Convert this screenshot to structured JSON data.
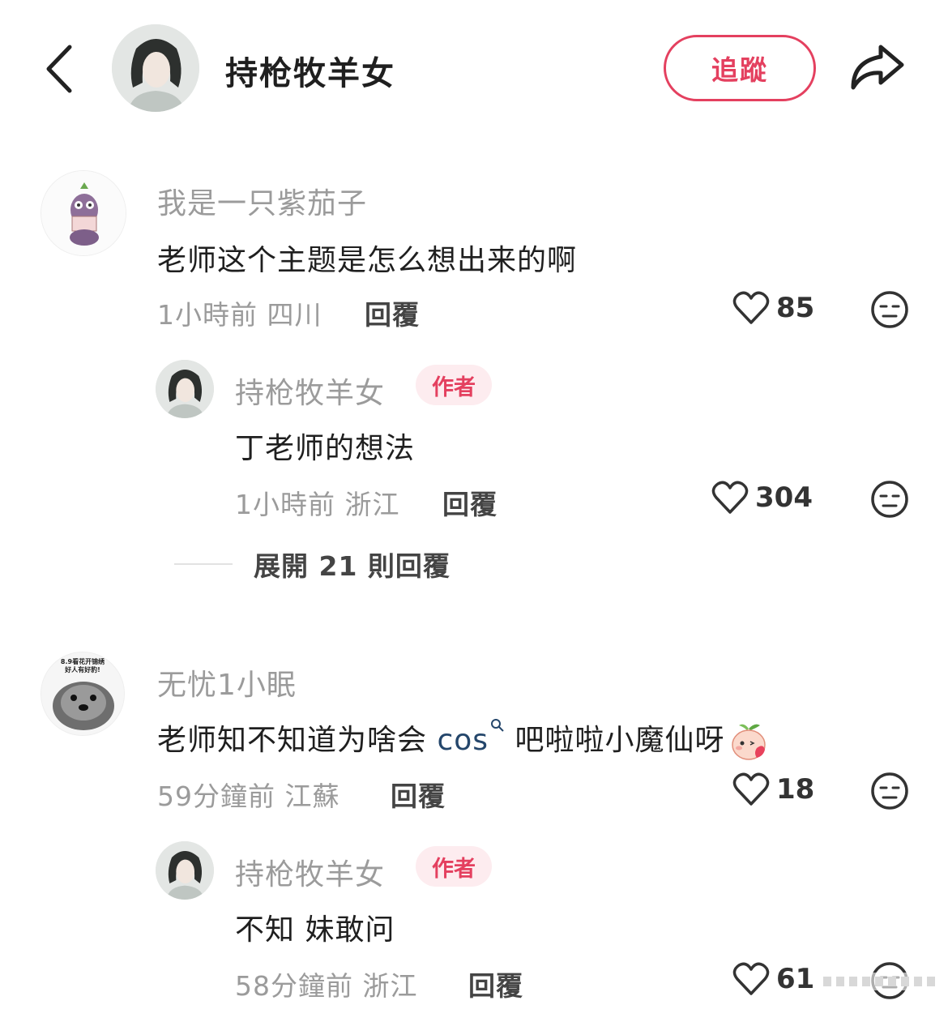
{
  "header": {
    "title": "持枪牧羊女",
    "follow_label": "追蹤",
    "back_icon": "chevron-left-icon",
    "share_icon": "share-arrow-icon"
  },
  "comments": [
    {
      "user": "我是一只紫茄子",
      "text": "老师这个主题是怎么想出来的啊",
      "time": "1小時前",
      "location": "四川",
      "reply_label": "回覆",
      "likes": "85",
      "replies": [
        {
          "user": "持枪牧羊女",
          "badge": "作者",
          "text": "丁老师的想法",
          "time": "1小時前",
          "location": "浙江",
          "reply_label": "回覆",
          "likes": "304"
        }
      ],
      "expand_label": "展開 21 則回覆"
    },
    {
      "user": "无忧1小眠",
      "avatar_caption_1": "8.9看花开锦绣",
      "avatar_caption_2": "好人有好豹!",
      "text_before": "老师知不知道为啥会 ",
      "text_link": "cos",
      "text_after": " 吧啦啦小魔仙呀",
      "time": "59分鐘前",
      "location": "江蘇",
      "reply_label": "回覆",
      "likes": "18",
      "replies": [
        {
          "user": "持枪牧羊女",
          "badge": "作者",
          "text": "不知 妹敢问",
          "time": "58分鐘前",
          "location": "浙江",
          "reply_label": "回覆",
          "likes": "61"
        }
      ]
    }
  ],
  "colors": {
    "accent": "#e4405f",
    "muted": "#9b9b9b",
    "link": "#24466b"
  }
}
